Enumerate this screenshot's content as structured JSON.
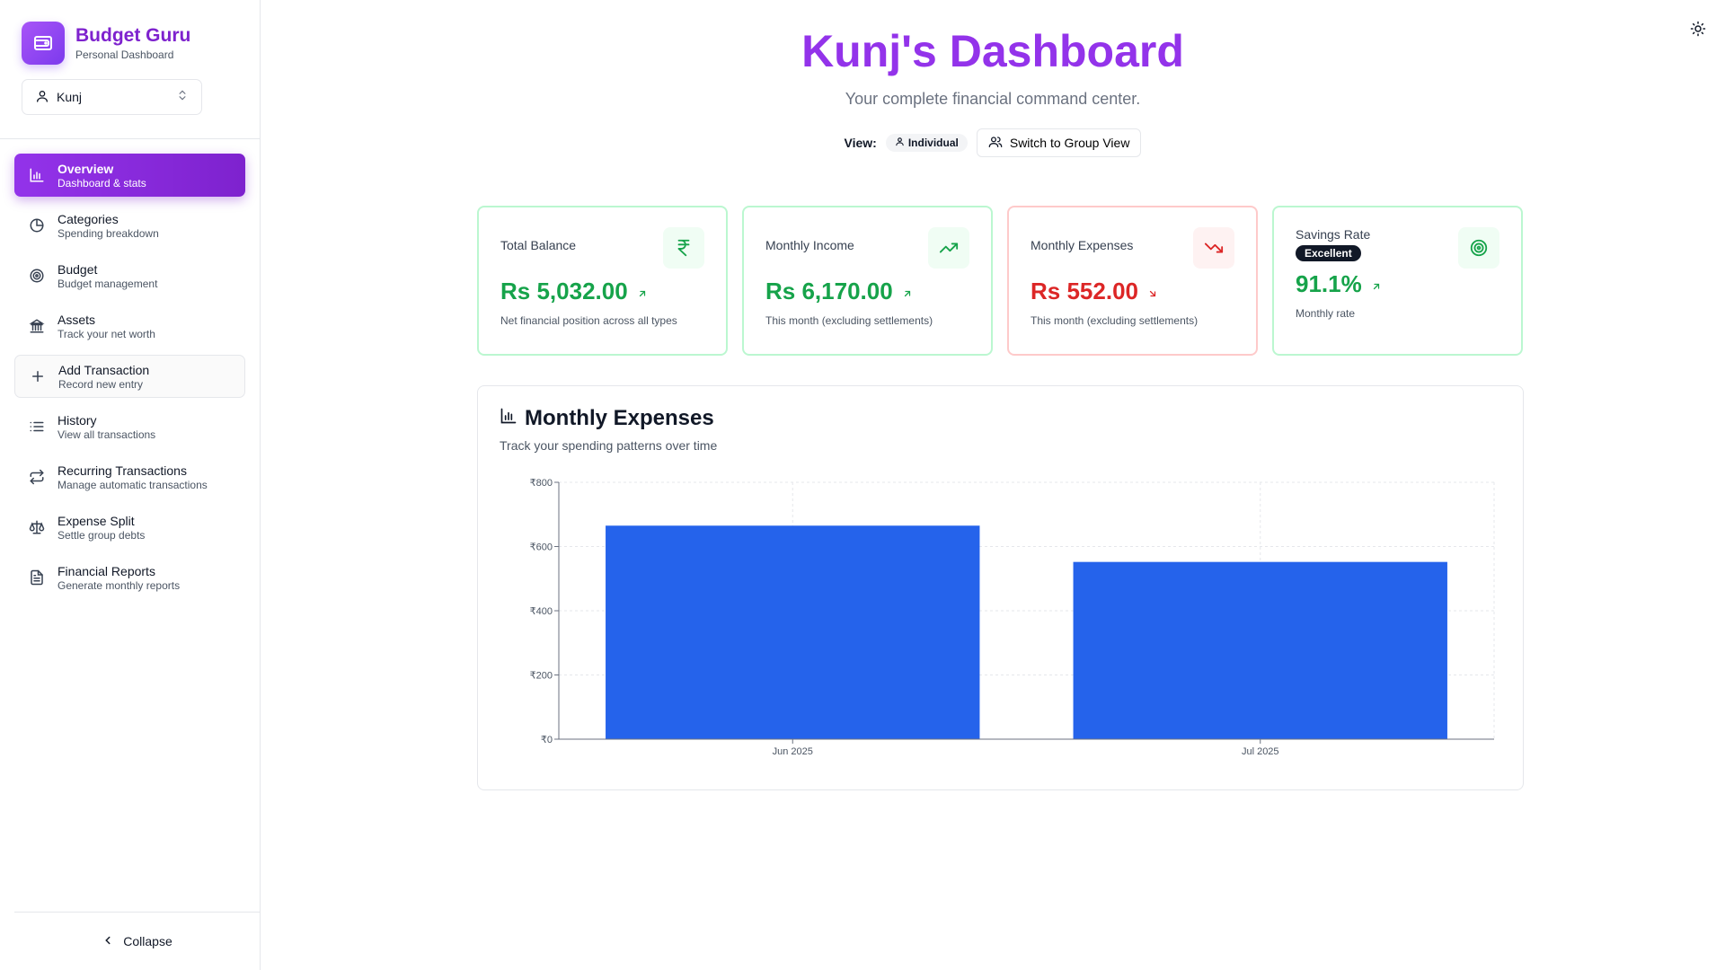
{
  "brand": {
    "title": "Budget Guru",
    "subtitle": "Personal Dashboard"
  },
  "user_select": {
    "value": "Kunj"
  },
  "nav": [
    {
      "label": "Overview",
      "desc": "Dashboard & stats",
      "icon": "bar-chart-icon",
      "active": true
    },
    {
      "label": "Categories",
      "desc": "Spending breakdown",
      "icon": "pie-chart-icon"
    },
    {
      "label": "Budget",
      "desc": "Budget management",
      "icon": "target-icon"
    },
    {
      "label": "Assets",
      "desc": "Track your net worth",
      "icon": "bank-icon"
    },
    {
      "label": "Add Transaction",
      "desc": "Record new entry",
      "icon": "plus-icon"
    },
    {
      "label": "History",
      "desc": "View all transactions",
      "icon": "list-icon"
    },
    {
      "label": "Recurring Transactions",
      "desc": "Manage automatic transactions",
      "icon": "repeat-icon"
    },
    {
      "label": "Expense Split",
      "desc": "Settle group debts",
      "icon": "scale-icon"
    },
    {
      "label": "Financial Reports",
      "desc": "Generate monthly reports",
      "icon": "document-icon"
    }
  ],
  "collapse_label": "Collapse",
  "header": {
    "title": "Kunj's Dashboard",
    "subtitle": "Your complete financial command center.",
    "view_label": "View:",
    "view_mode": "Individual",
    "switch_button": "Switch to Group View"
  },
  "cards": {
    "balance": {
      "title": "Total Balance",
      "value": "Rs 5,032.00",
      "note": "Net financial position across all types"
    },
    "income": {
      "title": "Monthly Income",
      "value": "Rs 6,170.00",
      "note": "This month (excluding settlements)"
    },
    "expenses": {
      "title": "Monthly Expenses",
      "value": "Rs 552.00",
      "note": "This month (excluding settlements)"
    },
    "savings": {
      "title": "Savings Rate",
      "badge": "Excellent",
      "value": "91.1%",
      "note": "Monthly rate"
    }
  },
  "colors": {
    "accent": "#9333ea",
    "positive": "#16a34a",
    "negative": "#dc2626",
    "bar": "#2563eb"
  },
  "chart_data": {
    "type": "bar",
    "title": "Monthly Expenses",
    "subtitle": "Track your spending patterns over time",
    "categories": [
      "Jun 2025",
      "Jul 2025"
    ],
    "values": [
      665,
      552
    ],
    "ylim": [
      0,
      800
    ],
    "yticks": [
      0,
      200,
      400,
      600,
      800
    ],
    "ytick_labels": [
      "₹0",
      "₹200",
      "₹400",
      "₹600",
      "₹800"
    ],
    "grid": true
  }
}
